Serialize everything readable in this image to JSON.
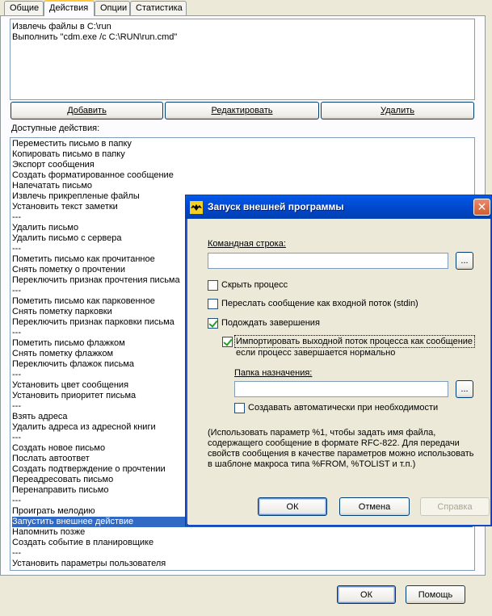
{
  "tabs": [
    {
      "label": "Общие",
      "active": false
    },
    {
      "label": "Действия",
      "active": true
    },
    {
      "label": "Опции",
      "active": false
    },
    {
      "label": "Статистика",
      "active": false
    }
  ],
  "actions_list": [
    "Извлечь файлы в C:\\run",
    "Выполнить \"cdm.exe /c C:\\RUN\\run.cmd\""
  ],
  "action_buttons": {
    "add": "Добавить",
    "edit": "Редактировать",
    "delete": "Удалить"
  },
  "available_label": "Доступные действия:",
  "available_actions": [
    "Переместить письмо в папку",
    "Копировать письмо в папку",
    "Экспорт сообщения",
    "Создать форматированное сообщение",
    "Напечатать письмо",
    "Извлечь прикрепленые файлы",
    "Установить текст заметки",
    "---",
    "Удалить письмо",
    "Удалить письмо с сервера",
    "---",
    "Пометить письмо как прочитанное",
    "Снять пометку о прочтении",
    "Переключить признак прочтения письма",
    "---",
    "Пометить письмо как парковенное",
    "Снять пометку парковки",
    "Переключить признак парковки письма",
    "---",
    "Пометить письмо флажком",
    "Снять пометку флажком",
    "Переключить флажок письма",
    "---",
    "Установить цвет сообщения",
    "Установить приоритет письма",
    "---",
    "Взять адреса",
    "Удалить адреса из адресной книги",
    "---",
    "Создать новое письмо",
    "Послать автоответ",
    "Создать подтверждение о прочтении",
    "Переадресовать письмо",
    "Перенаправить письмо",
    "---",
    "Проиграть мелодию",
    "Запустить внешнее действие",
    "Напомнить позже",
    "Создать событие в планировщике",
    "---",
    "Установить параметры пользователя"
  ],
  "selected_index": 36,
  "bottom_buttons": {
    "ok": "ОК",
    "help": "Помощь"
  },
  "dialog": {
    "title": "Запуск внешней программы",
    "command_label": "Командная строка:",
    "command_value": "",
    "browse": "...",
    "hide_process": {
      "label": "Скрыть процесс",
      "checked": false
    },
    "send_stdin": {
      "label": "Переслать сообщение как входной поток (stdin)",
      "checked": false
    },
    "wait_finish": {
      "label": "Подождать завершения",
      "checked": true
    },
    "import_output": {
      "label_line1": "Импортировать выходной поток процесса как сообщение",
      "label_line2": "если процесс завершается нормально",
      "checked": true
    },
    "folder_label": "Папка назначения:",
    "folder_value": "",
    "auto_create": {
      "label": "Создавать автоматически при необходимости",
      "checked": false
    },
    "note_lines": [
      "(Использовать параметр %1, чтобы задать имя файла,",
      "содержащего сообщение в формате RFC-822. Для передачи",
      "свойств сообщения в качестве параметров можно использовать",
      "в шаблоне макроса типа %FROM, %TOLIST и т.п.)"
    ],
    "ok": "ОК",
    "cancel": "Отмена",
    "help": "Справка"
  }
}
